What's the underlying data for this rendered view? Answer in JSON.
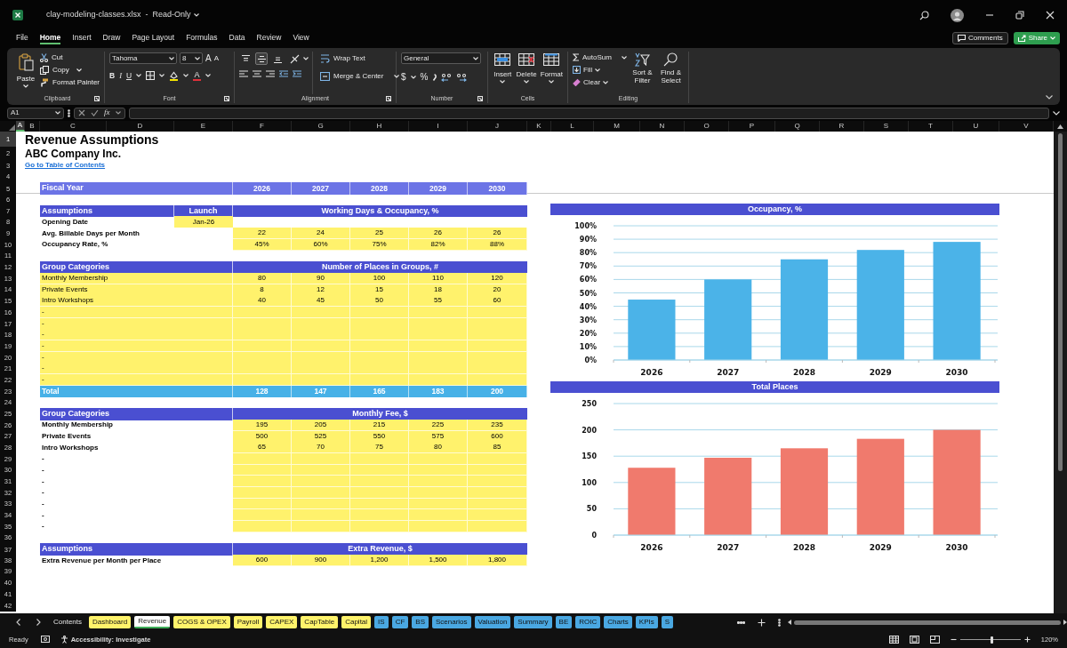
{
  "window": {
    "title": "clay-modeling-classes.xlsx",
    "separator": "-",
    "mode": "Read-Only"
  },
  "ribbon_tabs": [
    {
      "label": "File",
      "selected": false
    },
    {
      "label": "Home",
      "selected": true
    },
    {
      "label": "Insert",
      "selected": false
    },
    {
      "label": "Draw",
      "selected": false
    },
    {
      "label": "Page Layout",
      "selected": false
    },
    {
      "label": "Formulas",
      "selected": false
    },
    {
      "label": "Data",
      "selected": false
    },
    {
      "label": "Review",
      "selected": false
    },
    {
      "label": "View",
      "selected": false
    }
  ],
  "header_buttons": {
    "comments": "Comments",
    "share": "Share"
  },
  "ribbon": {
    "clipboard": {
      "label": "Clipboard",
      "paste": "Paste",
      "cut": "Cut",
      "copy": "Copy",
      "format_painter": "Format Painter"
    },
    "font": {
      "label": "Font",
      "font_name": "Tahoma",
      "font_size": "8",
      "size_buttons": [
        "A",
        "A"
      ],
      "style_buttons": [
        "B",
        "I",
        "U"
      ],
      "color_button": "A"
    },
    "alignment": {
      "label": "Alignment",
      "vertical_align": [
        {
          "selected": false
        },
        {
          "selected": true
        },
        {
          "selected": false
        }
      ],
      "wrap_text": "Wrap Text",
      "merge_center": "Merge & Center"
    },
    "number": {
      "label": "Number",
      "format": "General",
      "symbols": [
        "$",
        "%"
      ]
    },
    "cells": {
      "label": "Cells",
      "buttons": [
        "Insert",
        "Delete",
        "Format"
      ]
    },
    "editing": {
      "label": "Editing",
      "autosum": "AutoSum",
      "fill": "Fill",
      "clear": "Clear",
      "sort_filter": "Sort & Filter",
      "find_select": "Find & Select"
    }
  },
  "formula_bar": {
    "name_box": "A1",
    "fx": "fx"
  },
  "sheet": {
    "columns": [
      {
        "label": "A",
        "selected": true
      },
      {
        "label": "B",
        "selected": false
      },
      {
        "label": "C",
        "selected": false
      },
      {
        "label": "D",
        "selected": false
      },
      {
        "label": "E",
        "selected": false
      },
      {
        "label": "F",
        "selected": false
      },
      {
        "label": "G",
        "selected": false
      },
      {
        "label": "H",
        "selected": false
      },
      {
        "label": "I",
        "selected": false
      },
      {
        "label": "J",
        "selected": false
      },
      {
        "label": "K",
        "selected": false
      },
      {
        "label": "L",
        "selected": false
      },
      {
        "label": "M",
        "selected": false
      },
      {
        "label": "N",
        "selected": false
      },
      {
        "label": "O",
        "selected": false
      },
      {
        "label": "P",
        "selected": false
      },
      {
        "label": "Q",
        "selected": false
      },
      {
        "label": "R",
        "selected": false
      },
      {
        "label": "S",
        "selected": false
      },
      {
        "label": "T",
        "selected": false
      },
      {
        "label": "U",
        "selected": false
      },
      {
        "label": "V",
        "selected": false
      }
    ],
    "rows": [
      {
        "number": "1",
        "selected": true,
        "kind": "title",
        "text": "Revenue Assumptions"
      },
      {
        "number": "2",
        "selected": false,
        "kind": "subtitle",
        "text": "ABC Company Inc."
      },
      {
        "number": "3",
        "selected": false,
        "kind": "link",
        "text": "Go to Table of Contents"
      },
      {
        "number": "4",
        "selected": false,
        "kind": "blank"
      },
      {
        "number": "5",
        "selected": false,
        "kind": "years",
        "label": "Fiscal Year",
        "values": [
          "2026",
          "2027",
          "2028",
          "2029",
          "2030"
        ]
      },
      {
        "number": "6",
        "selected": false,
        "kind": "blank"
      },
      {
        "number": "7",
        "selected": false,
        "kind": "section",
        "label": "Assumptions",
        "column_e": "Launch",
        "title": "Working Days & Occupancy, %"
      },
      {
        "number": "8",
        "selected": false,
        "kind": "data",
        "label": "Opening Date",
        "label_bold": true,
        "label_input": false,
        "column_e": "Jan-26",
        "column_e_input": true,
        "values_input": false
      },
      {
        "number": "9",
        "selected": false,
        "kind": "data",
        "label": "Avg. Billable Days per Month",
        "label_bold": true,
        "label_input": false,
        "values_input": true,
        "values": [
          "22",
          "24",
          "25",
          "26",
          "26"
        ]
      },
      {
        "number": "10",
        "selected": false,
        "kind": "data",
        "label": "Occupancy Rate, %",
        "label_bold": true,
        "label_input": false,
        "values_input": true,
        "values": [
          "45%",
          "60%",
          "75%",
          "82%",
          "88%"
        ]
      },
      {
        "number": "11",
        "selected": false,
        "kind": "blank"
      },
      {
        "number": "12",
        "selected": false,
        "kind": "section",
        "label": "Group Categories",
        "title": "Number of Places in Groups, #"
      },
      {
        "number": "13",
        "selected": false,
        "kind": "data",
        "label": "Monthly Membership",
        "label_bold": false,
        "label_input": true,
        "values_input": true,
        "values": [
          "80",
          "90",
          "100",
          "110",
          "120"
        ]
      },
      {
        "number": "14",
        "selected": false,
        "kind": "data",
        "label": "Private Events",
        "label_bold": false,
        "label_input": true,
        "values_input": true,
        "values": [
          "8",
          "12",
          "15",
          "18",
          "20"
        ]
      },
      {
        "number": "15",
        "selected": false,
        "kind": "data",
        "label": "Intro Workshops",
        "label_bold": false,
        "label_input": true,
        "values_input": true,
        "values": [
          "40",
          "45",
          "50",
          "55",
          "60"
        ]
      },
      {
        "number": "16",
        "selected": false,
        "kind": "data",
        "label": "-",
        "label_bold": false,
        "label_input": true,
        "values_input": true
      },
      {
        "number": "17",
        "selected": false,
        "kind": "data",
        "label": "-",
        "label_bold": false,
        "label_input": true,
        "values_input": true
      },
      {
        "number": "18",
        "selected": false,
        "kind": "data",
        "label": "-",
        "label_bold": false,
        "label_input": true,
        "values_input": true
      },
      {
        "number": "19",
        "selected": false,
        "kind": "data",
        "label": "-",
        "label_bold": false,
        "label_input": true,
        "values_input": true
      },
      {
        "number": "20",
        "selected": false,
        "kind": "data",
        "label": "-",
        "label_bold": false,
        "label_input": true,
        "values_input": true
      },
      {
        "number": "21",
        "selected": false,
        "kind": "data",
        "label": "-",
        "label_bold": false,
        "label_input": true,
        "values_input": true
      },
      {
        "number": "22",
        "selected": false,
        "kind": "data",
        "label": "-",
        "label_bold": false,
        "label_input": true,
        "values_input": true
      },
      {
        "number": "23",
        "selected": false,
        "kind": "total",
        "label": "Total",
        "values": [
          "128",
          "147",
          "165",
          "183",
          "200"
        ]
      },
      {
        "number": "24",
        "selected": false,
        "kind": "blank"
      },
      {
        "number": "25",
        "selected": false,
        "kind": "section",
        "label": "Group Categories",
        "title": "Monthly Fee, $"
      },
      {
        "number": "26",
        "selected": false,
        "kind": "data",
        "label": "Monthly Membership",
        "label_bold": true,
        "label_input": false,
        "values_input": true,
        "values": [
          "195",
          "205",
          "215",
          "225",
          "235"
        ]
      },
      {
        "number": "27",
        "selected": false,
        "kind": "data",
        "label": "Private Events",
        "label_bold": true,
        "label_input": false,
        "values_input": true,
        "values": [
          "500",
          "525",
          "550",
          "575",
          "600"
        ]
      },
      {
        "number": "28",
        "selected": false,
        "kind": "data",
        "label": "Intro Workshops",
        "label_bold": true,
        "label_input": false,
        "values_input": true,
        "values": [
          "65",
          "70",
          "75",
          "80",
          "85"
        ]
      },
      {
        "number": "29",
        "selected": false,
        "kind": "data",
        "label": "-",
        "label_bold": true,
        "label_input": false,
        "values_input": true
      },
      {
        "number": "30",
        "selected": false,
        "kind": "data",
        "label": "-",
        "label_bold": true,
        "label_input": false,
        "values_input": true
      },
      {
        "number": "31",
        "selected": false,
        "kind": "data",
        "label": "-",
        "label_bold": true,
        "label_input": false,
        "values_input": true
      },
      {
        "number": "32",
        "selected": false,
        "kind": "data",
        "label": "-",
        "label_bold": true,
        "label_input": false,
        "values_input": true
      },
      {
        "number": "33",
        "selected": false,
        "kind": "data",
        "label": "-",
        "label_bold": true,
        "label_input": false,
        "values_input": true
      },
      {
        "number": "34",
        "selected": false,
        "kind": "data",
        "label": "-",
        "label_bold": true,
        "label_input": false,
        "values_input": true
      },
      {
        "number": "35",
        "selected": false,
        "kind": "data",
        "label": "-",
        "label_bold": true,
        "label_input": false,
        "values_input": true
      },
      {
        "number": "36",
        "selected": false,
        "kind": "blank"
      },
      {
        "number": "37",
        "selected": false,
        "kind": "section",
        "label": "Assumptions",
        "title": "Extra Revenue, $"
      },
      {
        "number": "38",
        "selected": false,
        "kind": "data",
        "label": "Extra Revenue per Month per Place",
        "label_bold": true,
        "label_input": false,
        "values_input": true,
        "values": [
          "600",
          "900",
          "1,200",
          "1,500",
          "1,800"
        ]
      },
      {
        "number": "39",
        "selected": false,
        "kind": "blank"
      },
      {
        "number": "40",
        "selected": false,
        "kind": "blank"
      },
      {
        "number": "41",
        "selected": false,
        "kind": "blank"
      },
      {
        "number": "42",
        "selected": false,
        "kind": "blank"
      }
    ]
  },
  "charts": [
    {
      "chart_data": {
        "type": "bar",
        "title": "Occupancy, %",
        "categories": [
          "2026",
          "2027",
          "2028",
          "2029",
          "2030"
        ],
        "series": [
          {
            "color": "#4bb3e8",
            "values": [
              45,
              60,
              75,
              82,
              88
            ]
          }
        ],
        "grid": true,
        "ylim": [
          0,
          100
        ],
        "yticks": [
          {
            "value": 0,
            "label": "0%"
          },
          {
            "value": 10,
            "label": "10%"
          },
          {
            "value": 20,
            "label": "20%"
          },
          {
            "value": 30,
            "label": "30%"
          },
          {
            "value": 40,
            "label": "40%"
          },
          {
            "value": 50,
            "label": "50%"
          },
          {
            "value": 60,
            "label": "60%"
          },
          {
            "value": 70,
            "label": "70%"
          },
          {
            "value": 80,
            "label": "80%"
          },
          {
            "value": 90,
            "label": "90%"
          },
          {
            "value": 100,
            "label": "100%"
          }
        ]
      }
    },
    {
      "chart_data": {
        "type": "bar",
        "title": "Total Places",
        "categories": [
          "2026",
          "2027",
          "2028",
          "2029",
          "2030"
        ],
        "series": [
          {
            "color": "#f07a6d",
            "values": [
              128,
              147,
              165,
              183,
              200
            ]
          }
        ],
        "grid": true,
        "ylim": [
          0,
          250
        ],
        "yticks": [
          0,
          50,
          100,
          150,
          200,
          250
        ]
      }
    }
  ],
  "sheet_tabs": [
    {
      "label": "Contents",
      "selected": false
    },
    {
      "label": "Dashboard",
      "selected": false,
      "color": "#fff36b"
    },
    {
      "label": "Revenue",
      "selected": true
    },
    {
      "label": "COGS & OPEX",
      "selected": false,
      "color": "#fff36b"
    },
    {
      "label": "Payroll",
      "selected": false,
      "color": "#fff36b"
    },
    {
      "label": "CAPEX",
      "selected": false,
      "color": "#fff36b"
    },
    {
      "label": "CapTable",
      "selected": false,
      "color": "#fff36b"
    },
    {
      "label": "Capital",
      "selected": false,
      "color": "#fff36b"
    },
    {
      "label": "IS",
      "selected": false,
      "color": "#4aa8e2"
    },
    {
      "label": "CF",
      "selected": false,
      "color": "#4aa8e2"
    },
    {
      "label": "BS",
      "selected": false,
      "color": "#4aa8e2"
    },
    {
      "label": "Scenarios",
      "selected": false,
      "color": "#4aa8e2"
    },
    {
      "label": "Valuation",
      "selected": false,
      "color": "#4aa8e2"
    },
    {
      "label": "Summary",
      "selected": false,
      "color": "#4aa8e2"
    },
    {
      "label": "BE",
      "selected": false,
      "color": "#4aa8e2"
    },
    {
      "label": "ROIC",
      "selected": false,
      "color": "#4aa8e2"
    },
    {
      "label": "Charts",
      "selected": false,
      "color": "#4aa8e2"
    },
    {
      "label": "KPIs",
      "selected": false,
      "color": "#4aa8e2"
    },
    {
      "label": "S",
      "selected": false,
      "color": "#4aa8e2"
    }
  ],
  "status_bar": {
    "ready": "Ready",
    "accessibility": "Accessibility: Investigate",
    "zoom": {
      "label": "120%",
      "level": 0.52
    }
  }
}
